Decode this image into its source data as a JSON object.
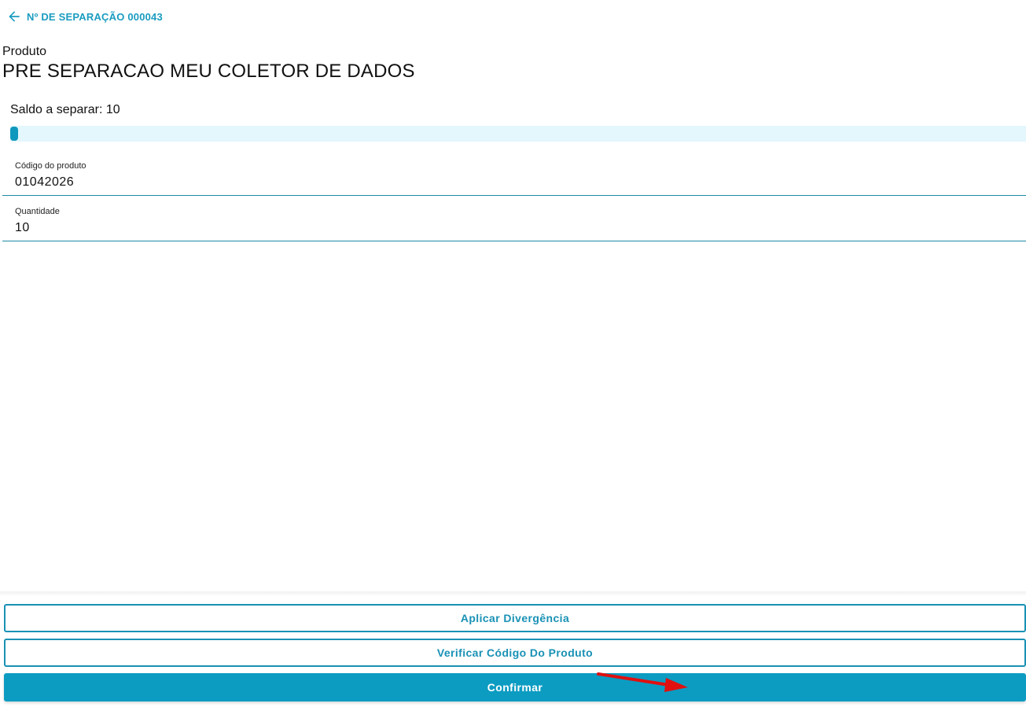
{
  "header": {
    "back_icon": "arrow-left-icon",
    "title": "Nº DE SEPARAÇÃO 000043"
  },
  "product": {
    "label": "Produto",
    "name": "PRE SEPARACAO MEU COLETOR DE DADOS"
  },
  "saldo": {
    "text": "Saldo a separar: 10",
    "progress_fraction": 0.0
  },
  "fields": {
    "code": {
      "label": "Código do produto",
      "value": "01042026"
    },
    "quantity": {
      "label": "Quantidade",
      "value": "10"
    }
  },
  "actions": {
    "divergence_label": "Aplicar Divergência",
    "verify_label": "Verificar Código Do Produto",
    "confirm_label": "Confirmar"
  },
  "colors": {
    "accent": "#1a9cc0",
    "primary_button": "#0c9cc2",
    "progress_track": "#e3f7fd",
    "annotation_arrow": "#e01010"
  }
}
